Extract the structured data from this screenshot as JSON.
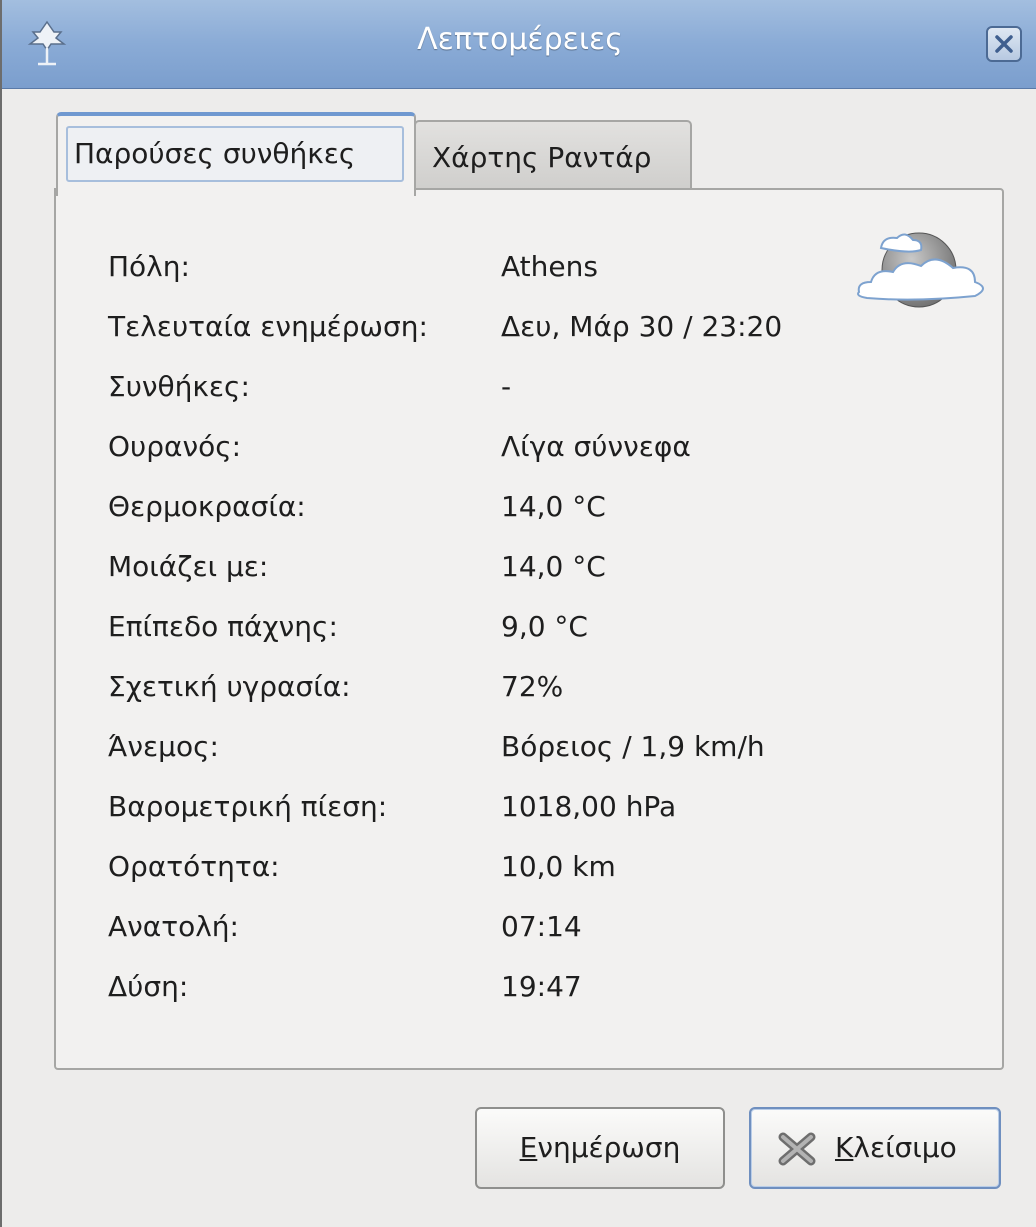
{
  "window": {
    "title": "Λεπτομέρειες"
  },
  "tabs": [
    {
      "label": "Παρούσες συνθήκες",
      "active": true
    },
    {
      "label": "Χάρτης Ραντάρ",
      "active": false
    }
  ],
  "details": [
    {
      "label": "Πόλη:",
      "value": "Athens"
    },
    {
      "label": "Τελευταία ενημέρωση:",
      "value": "Δευ, Μάρ 30 / 23:20"
    },
    {
      "label": "Συνθήκες:",
      "value": "-"
    },
    {
      "label": "Ουρανός:",
      "value": "Λίγα σύννεφα"
    },
    {
      "label": "Θερμοκρασία:",
      "value": "14,0 °C"
    },
    {
      "label": "Μοιάζει με:",
      "value": "14,0 °C"
    },
    {
      "label": "Επίπεδο πάχνης:",
      "value": "9,0 °C"
    },
    {
      "label": "Σχετική υγρασία:",
      "value": "72%"
    },
    {
      "label": "Άνεμος:",
      "value": "Βόρειος / 1,9 km/h"
    },
    {
      "label": "Βαρομετρική πίεση:",
      "value": "1018,00 hPa"
    },
    {
      "label": "Ορατότητα:",
      "value": "10,0 km"
    },
    {
      "label": "Ανατολή:",
      "value": "07:14"
    },
    {
      "label": "Δύση:",
      "value": "19:47"
    }
  ],
  "buttons": {
    "update": {
      "mnemonic": "Ε",
      "rest": "νημέρωση"
    },
    "close": {
      "mnemonic": "Κ",
      "rest": "λείσιμο",
      "icon": "close-x-icon"
    }
  },
  "icons": {
    "app": "weather-app-icon",
    "condition": "moon-cloud-icon"
  },
  "colors": {
    "titlebar": "#8aabd6",
    "active_tab_accent": "#6f98d0"
  }
}
